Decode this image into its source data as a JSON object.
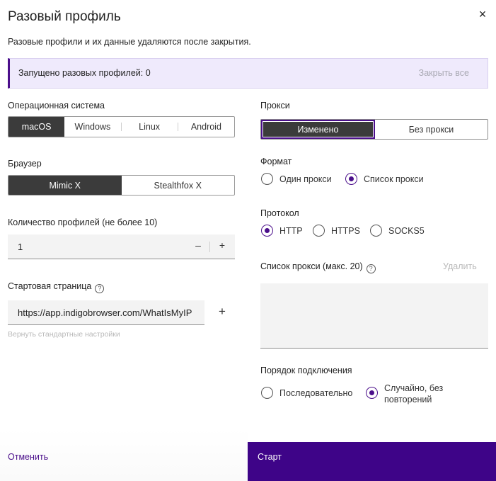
{
  "dialog": {
    "title": "Разовый профиль",
    "close_icon": "×",
    "subtitle": "Разовые профили и их данные удаляются после закрытия."
  },
  "banner": {
    "text": "Запущено разовых профилей: 0",
    "close_all": "Закрыть все",
    "accent": "#4b0f8b"
  },
  "os": {
    "label": "Операционная система",
    "options": [
      "macOS",
      "Windows",
      "Linux",
      "Android"
    ],
    "selected": "macOS"
  },
  "browser": {
    "label": "Браузер",
    "options": [
      "Mimic X",
      "Stealthfox X"
    ],
    "selected": "Mimic X"
  },
  "count": {
    "label": "Количество профилей (не более 10)",
    "value": "1",
    "minus": "–",
    "plus": "+"
  },
  "start_page": {
    "label": "Стартовая страница",
    "help_icon": "?",
    "value": "https://app.indigobrowser.com/WhatIsMyIP",
    "add": "+",
    "reset": "Вернуть стандартные настройки"
  },
  "proxy": {
    "label": "Прокси",
    "options": [
      "Изменено",
      "Без прокси"
    ],
    "selected": "Изменено"
  },
  "format": {
    "label": "Формат",
    "options": [
      "Один прокси",
      "Список прокси"
    ],
    "selected": "Список прокси"
  },
  "protocol": {
    "label": "Протокол",
    "options": [
      "HTTP",
      "HTTPS",
      "SOCKS5"
    ],
    "selected": "HTTP"
  },
  "proxy_list": {
    "label": "Список прокси (макс. 20)",
    "help_icon": "?",
    "delete": "Удалить",
    "value": ""
  },
  "connection_order": {
    "label": "Порядок подключения",
    "options": [
      "Последовательно",
      "Случайно, без повторений"
    ],
    "selected": "Случайно, без повторений"
  },
  "footer": {
    "cancel": "Отменить",
    "start": "Старт",
    "start_color": "#3e0488"
  }
}
